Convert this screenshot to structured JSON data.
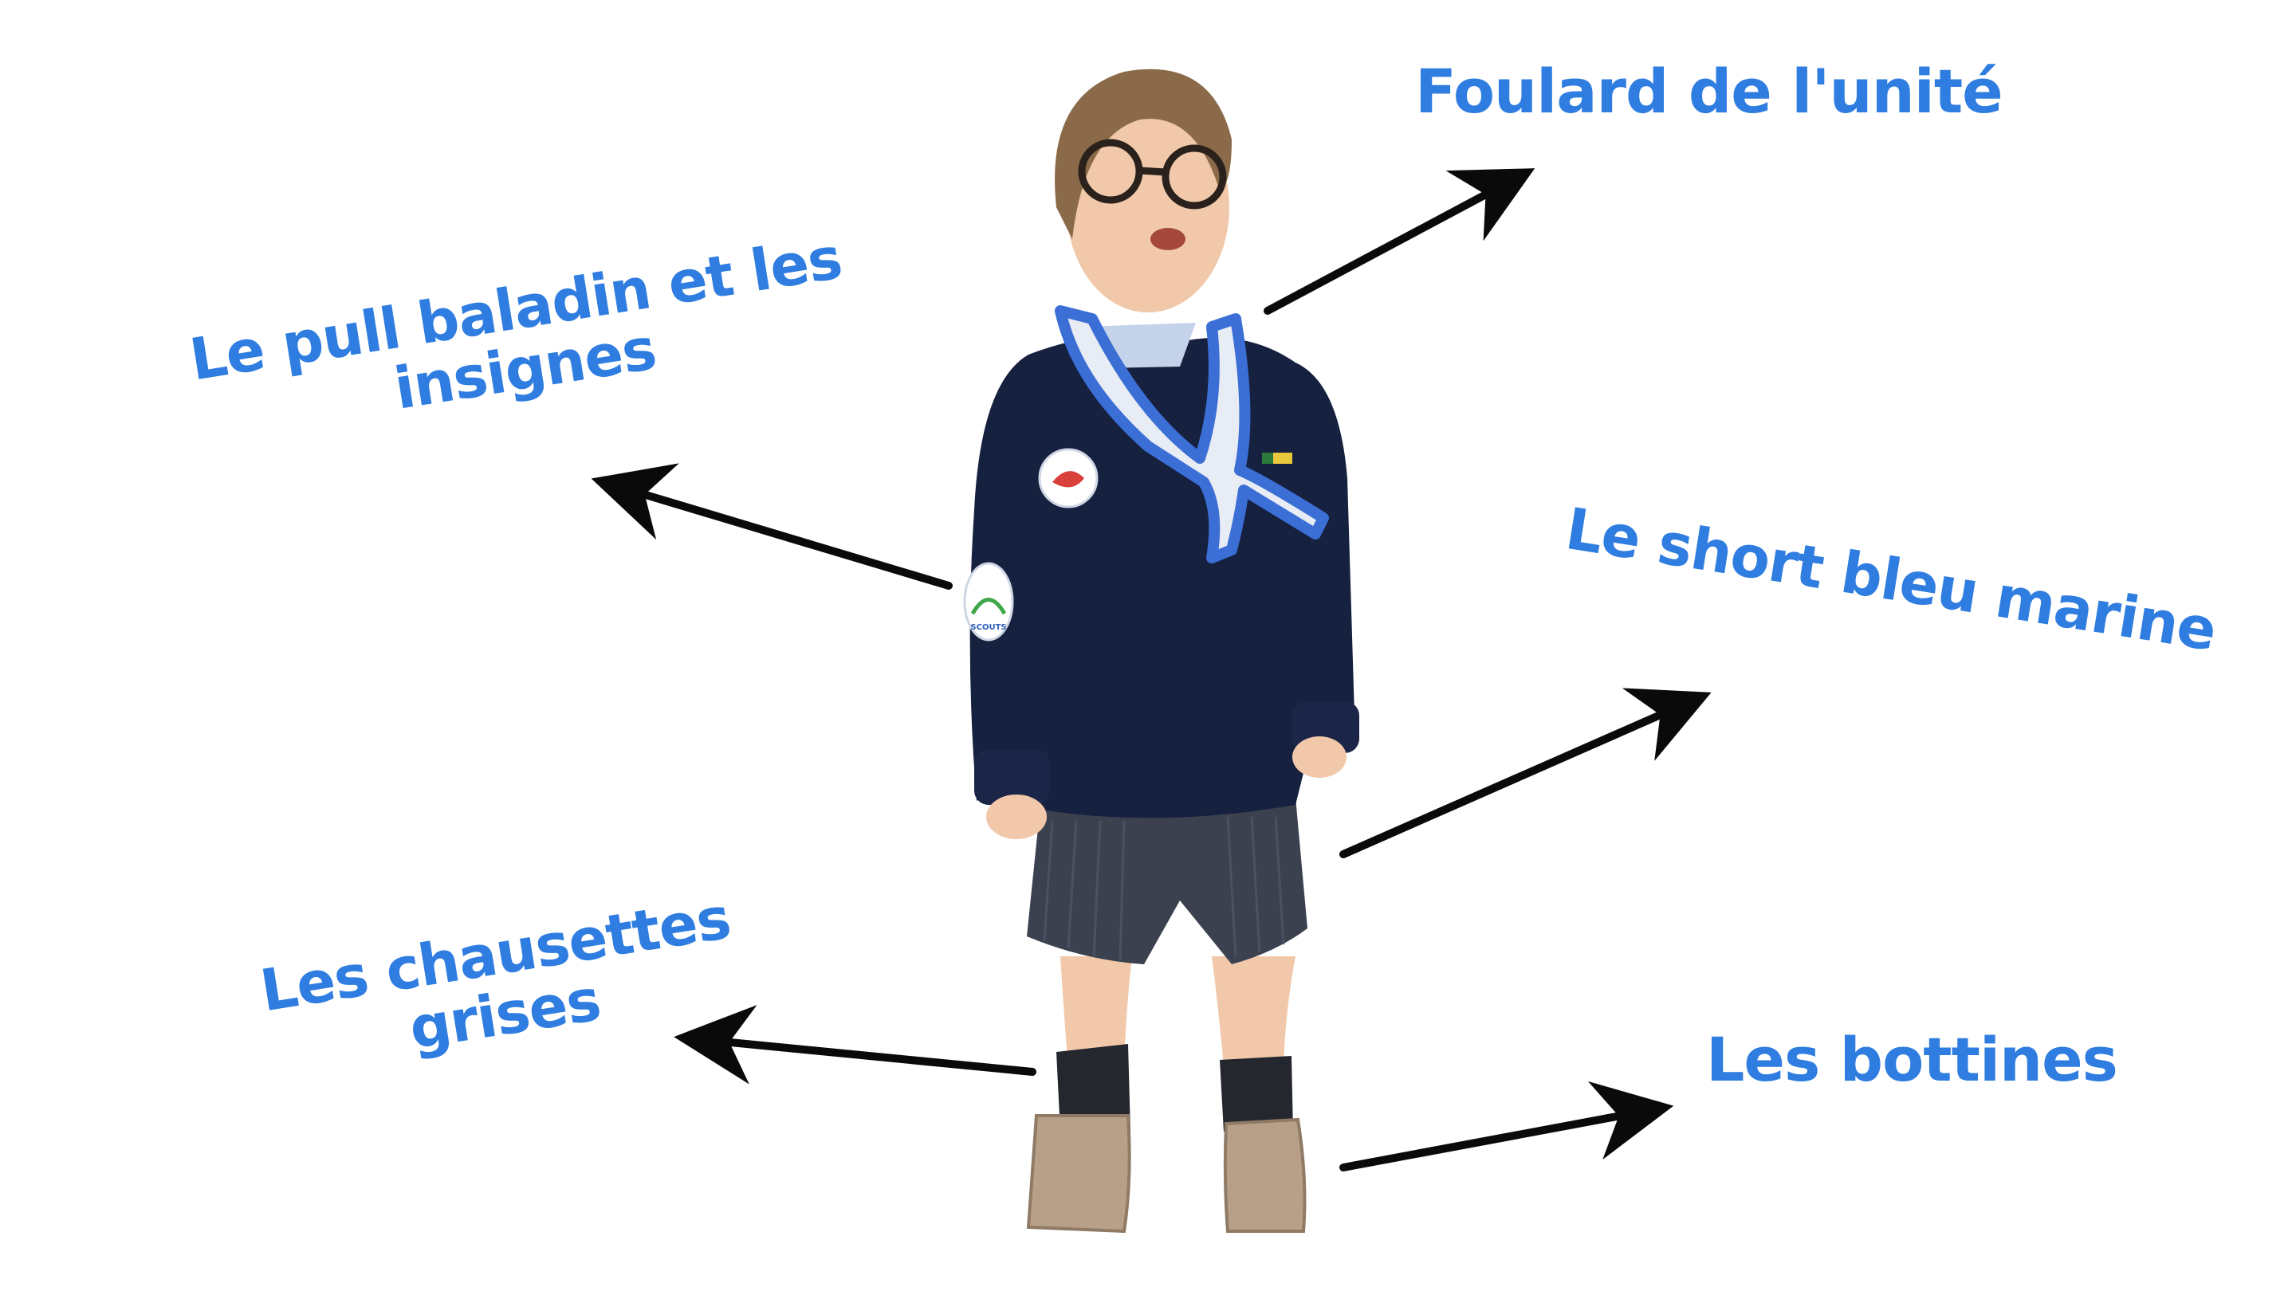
{
  "labels": {
    "foulard": "Foulard de l'unité",
    "pull_line1": "Le pull baladin et les",
    "pull_line2": "insignes",
    "short": "Le short bleu marine",
    "chaussettes_line1": "Les chausettes",
    "chaussettes_line2": "grises",
    "bottines": "Les bottines"
  },
  "badge_text": "SCOUTS",
  "colors": {
    "label": "#2f7de1",
    "arrow": "#0a0a0a",
    "sweater": "#16203f",
    "shorts": "#3c4150",
    "scarf_blue": "#3b6fd6",
    "scarf_white": "#e8ecf5",
    "skin": "#f1c9aa",
    "hair": "#8a6a48",
    "boots": "#b8a088",
    "socks": "#25272e"
  }
}
